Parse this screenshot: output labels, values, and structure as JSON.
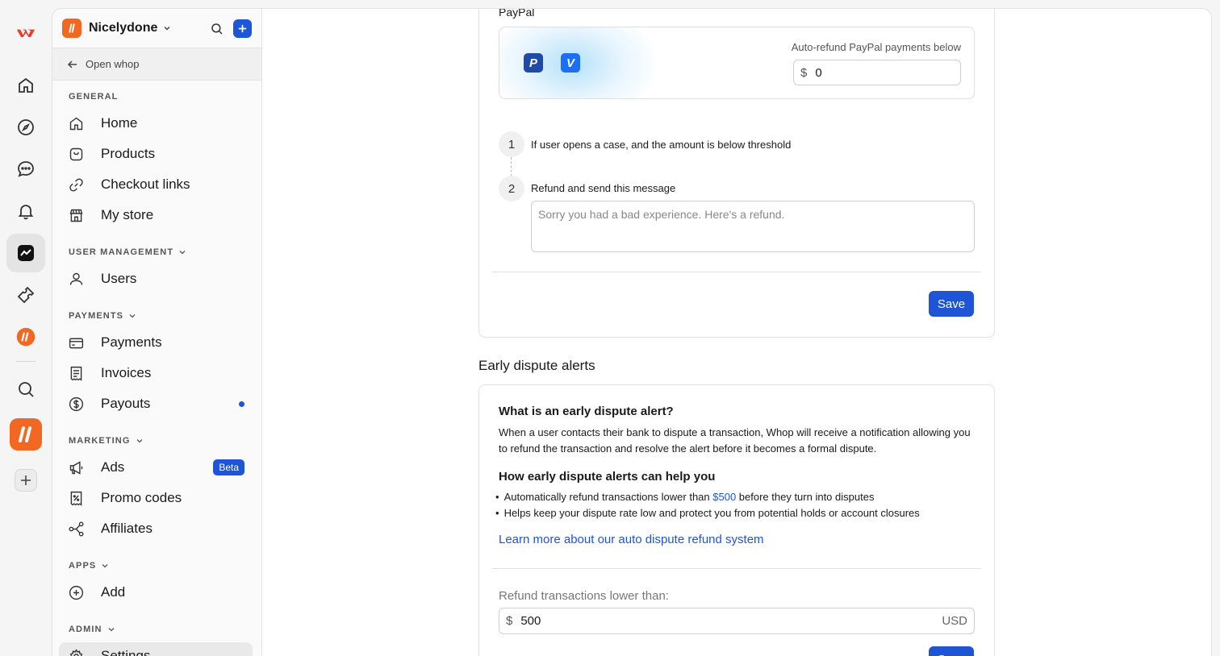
{
  "workspace": {
    "name": "Nicelydone"
  },
  "sidebar": {
    "open_whop": "Open whop",
    "sections": {
      "general": "GENERAL",
      "user_management": "USER MANAGEMENT",
      "payments": "PAYMENTS",
      "marketing": "MARKETING",
      "apps": "APPS",
      "admin": "ADMIN"
    },
    "items": {
      "home": "Home",
      "products": "Products",
      "checkout_links": "Checkout links",
      "my_store": "My store",
      "users": "Users",
      "payments": "Payments",
      "invoices": "Invoices",
      "payouts": "Payouts",
      "ads": "Ads",
      "ads_badge": "Beta",
      "promo_codes": "Promo codes",
      "affiliates": "Affiliates",
      "add": "Add",
      "settings": "Settings"
    }
  },
  "paypal": {
    "label": "PayPal",
    "auto_refund_label": "Auto-refund PayPal payments below",
    "currency_symbol": "$",
    "auto_refund_value": "0",
    "step1_num": "1",
    "step1_text": "If user opens a case, and the amount is below threshold",
    "step2_num": "2",
    "step2_text": "Refund and send this message",
    "message_placeholder": "Sorry you had a bad experience. Here's a refund.",
    "save_label": "Save"
  },
  "dispute": {
    "title": "Early dispute alerts",
    "q1": "What is an early dispute alert?",
    "p1": "When a user contacts their bank to dispute a transaction, Whop will receive a notification allowing you to refund the transaction and resolve the alert before it becomes a formal dispute.",
    "q2": "How early dispute alerts can help you",
    "b1_pre": "Automatically refund transactions lower than ",
    "b1_amount": "$500",
    "b1_post": " before they turn into disputes",
    "b2": "Helps keep your dispute rate low and protect you from potential holds or account closures",
    "learn_more": "Learn more about our auto dispute refund system",
    "refund_label": "Refund transactions lower than:",
    "currency_symbol": "$",
    "refund_value": "500",
    "refund_unit": "USD",
    "save_label": "Save"
  },
  "colors": {
    "accent": "#1d55d6",
    "brand": "#f26722"
  }
}
